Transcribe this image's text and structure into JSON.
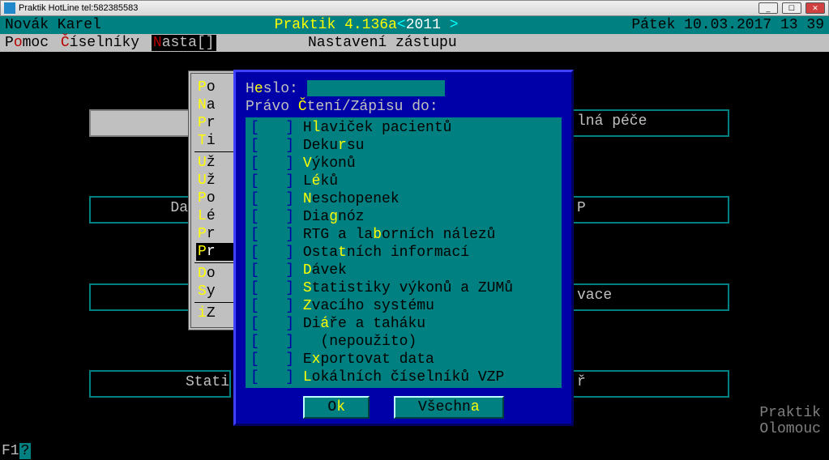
{
  "window_title": "Praktik HotLine tel:582385583",
  "header": {
    "user": "Novák Karel",
    "app": "Praktik 4.136a",
    "year_open": "<",
    "year": "2011",
    "year_close": " >",
    "date": "Pátek 10.03.2017 13 39"
  },
  "menu": {
    "items": [
      {
        "pre": "P",
        "hot": "o",
        "post": "moc"
      },
      {
        "pre": "",
        "hot": "Č",
        "post": "íselníky"
      },
      {
        "pre": "",
        "hot": "N",
        "post": "asta[]"
      }
    ],
    "title": "Nastavení zástupu"
  },
  "dropdown": {
    "groups": [
      [
        {
          "h": "P",
          "r": "o"
        },
        {
          "h": "N",
          "r": "a"
        },
        {
          "h": "P",
          "r": "r"
        },
        {
          "h": "T",
          "r": "i"
        }
      ],
      [
        {
          "h": "U",
          "r": "ž"
        },
        {
          "h": "U",
          "r": "ž"
        },
        {
          "h": "P",
          "r": "o"
        },
        {
          "h": "L",
          "r": "é"
        },
        {
          "h": "P",
          "r": "r"
        },
        {
          "h": "P",
          "r": "r",
          "sel": true
        }
      ],
      [
        {
          "h": "D",
          "r": "o"
        },
        {
          "h": "S",
          "r": "y"
        }
      ],
      [
        {
          "h": "i",
          "r": "Z"
        }
      ]
    ]
  },
  "dialog": {
    "heslo_label_pre": "H",
    "heslo_label_hot": "e",
    "heslo_label_post": "slo:",
    "pravo_label_pre": "Právo ",
    "pravo_label_hot": "Č",
    "pravo_label_post": "tení/Zápisu do:",
    "perms": [
      {
        "hk": "l",
        "pre": "H",
        "post": "aviček pacientů"
      },
      {
        "hk": "r",
        "pre": "Deku",
        "post": "su"
      },
      {
        "hk": "V",
        "pre": "",
        "post": "ýkonů"
      },
      {
        "hk": "é",
        "pre": "L",
        "post": "ků"
      },
      {
        "hk": "N",
        "pre": "",
        "post": "eschopenek"
      },
      {
        "hk": "g",
        "pre": "Dia",
        "post": "nóz"
      },
      {
        "hk": "b",
        "pre": "RTG a la",
        "post": "orních nálezů"
      },
      {
        "hk": "t",
        "pre": "Osta",
        "post": "ních informací"
      },
      {
        "hk": "D",
        "pre": "",
        "post": "ávek"
      },
      {
        "hk": "S",
        "pre": "",
        "post": "tatistiky výkonů a ZUMů"
      },
      {
        "hk": "Z",
        "pre": "",
        "post": "vacího systému"
      },
      {
        "hk": "á",
        "pre": "Di",
        "post": "ře a taháku"
      },
      {
        "hk": "",
        "pre": "  (nepoužito)",
        "post": ""
      },
      {
        "hk": "x",
        "pre": "E",
        "post": "portovat data"
      },
      {
        "hk": "L",
        "pre": "",
        "post": "okálních číselníků VZP"
      }
    ],
    "ok_pre": "O",
    "ok_hot": "k",
    "ok_post": "",
    "all_pre": "Všechn",
    "all_hot": "a",
    "all_post": ""
  },
  "bg_boxes": {
    "box1_text": "lná péče",
    "box2_text": "P",
    "box3_text": "vace",
    "box4_text": "ř",
    "left1_text": "Da",
    "left2_text": "Stati"
  },
  "footer_brand": {
    "l1": "Praktik",
    "l2": "Olomouc"
  },
  "fkey": "F1"
}
